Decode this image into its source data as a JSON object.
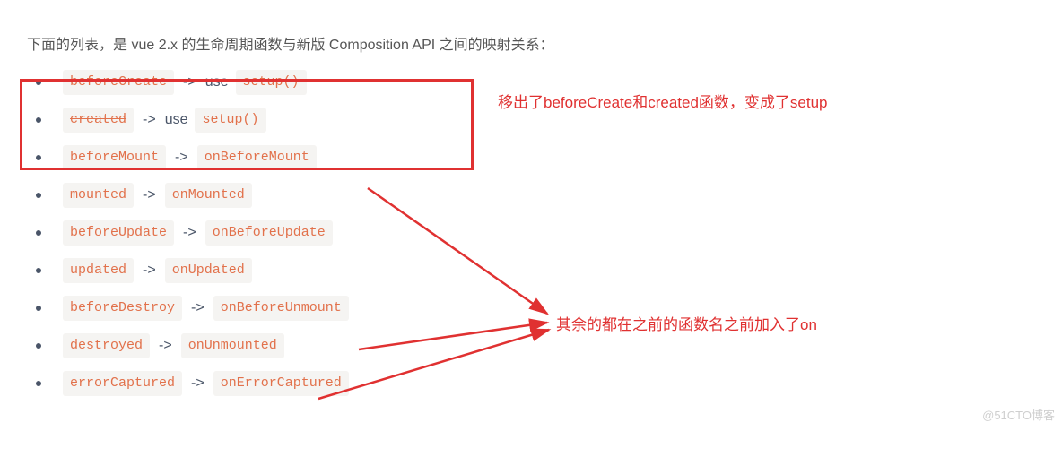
{
  "intro": "下面的列表，是 vue 2.x 的生命周期函数与新版 Composition API 之间的映射关系：",
  "items": [
    {
      "old": "beforeCreate",
      "new": "setup()",
      "strike": true,
      "use": true
    },
    {
      "old": "created",
      "new": "setup()",
      "strike": true,
      "use": true
    },
    {
      "old": "beforeMount",
      "new": "onBeforeMount",
      "strike": false,
      "use": false
    },
    {
      "old": "mounted",
      "new": "onMounted",
      "strike": false,
      "use": false
    },
    {
      "old": "beforeUpdate",
      "new": "onBeforeUpdate",
      "strike": false,
      "use": false
    },
    {
      "old": "updated",
      "new": "onUpdated",
      "strike": false,
      "use": false
    },
    {
      "old": "beforeDestroy",
      "new": "onBeforeUnmount",
      "strike": false,
      "use": false
    },
    {
      "old": "destroyed",
      "new": "onUnmounted",
      "strike": false,
      "use": false
    },
    {
      "old": "errorCaptured",
      "new": "onErrorCaptured",
      "strike": false,
      "use": false
    }
  ],
  "arrow_text": "->",
  "use_text": "use",
  "annotation_top": "移出了beforeCreate和created函数，变成了setup",
  "annotation_mid": "其余的都在之前的函数名之前加入了on",
  "watermark": "@51CTO博客"
}
